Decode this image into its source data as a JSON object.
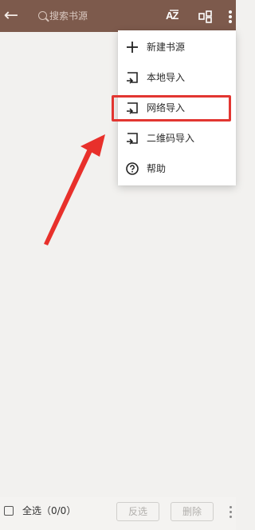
{
  "header": {
    "search_placeholder": "搜索书源",
    "sort_label": "AZ"
  },
  "menu": {
    "items": [
      {
        "label": "新建书源",
        "icon": "plus-icon"
      },
      {
        "label": "本地导入",
        "icon": "import-icon"
      },
      {
        "label": "网络导入",
        "icon": "import-icon",
        "highlighted": true
      },
      {
        "label": "二维码导入",
        "icon": "import-icon"
      },
      {
        "label": "帮助",
        "icon": "help-icon"
      }
    ]
  },
  "footer": {
    "select_all": "全选（0/0）",
    "invert_label": "反选",
    "delete_label": "删除"
  },
  "colors": {
    "header": "#7d5a4c",
    "highlight": "#e23631",
    "background": "#f2f1ef"
  }
}
